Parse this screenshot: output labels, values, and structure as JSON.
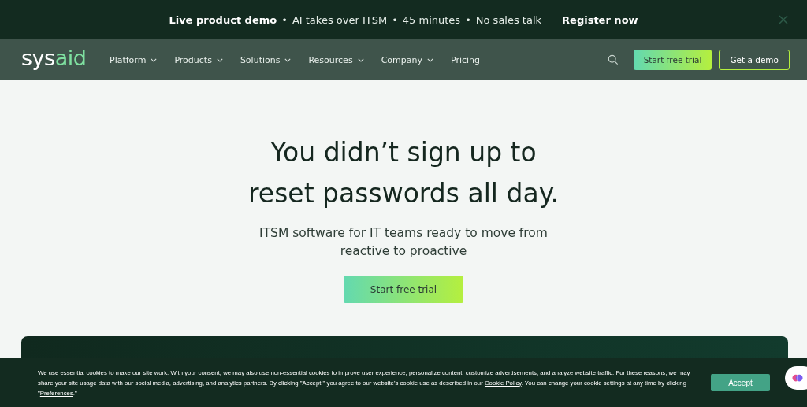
{
  "announcement": {
    "highlight": "Live product demo",
    "details": [
      "AI takes over ITSM",
      "45 minutes",
      "No sales talk"
    ],
    "separator": "•",
    "link": "Register now"
  },
  "nav": {
    "logo": {
      "first": "sys",
      "second": "aid"
    },
    "items": [
      {
        "label": "Platform",
        "dropdown": true
      },
      {
        "label": "Products",
        "dropdown": true
      },
      {
        "label": "Solutions",
        "dropdown": true
      },
      {
        "label": "Resources",
        "dropdown": true
      },
      {
        "label": "Company",
        "dropdown": true
      },
      {
        "label": "Pricing",
        "dropdown": false
      }
    ],
    "primary_button": "Start free trial",
    "secondary_button": "Get a demo"
  },
  "hero": {
    "headline": [
      "You didn’t sign up to",
      "reset passwords all day."
    ],
    "subtitle": [
      "ITSM software for IT teams ready to move from",
      "reactive to proactive"
    ],
    "button": "Start free trial"
  },
  "cookie_banner": {
    "text_before": "We use essential cookies to make our site work. With your consent, we may also use non-essential cookies to improve user experience, personalize content, customize advertisements, and analyze website traffic. For these reasons, we may share your site usage data with our social media, advertising, and analytics partners. By clicking \"Accept,\" you agree to our website's cookie use as described in our ",
    "policy_link": "Cookie Policy",
    "text_middle": ". You can change your cookie settings at any time by clicking \"",
    "preferences_link": "Preferences",
    "text_after": ".\"",
    "accept_button": "Accept"
  }
}
